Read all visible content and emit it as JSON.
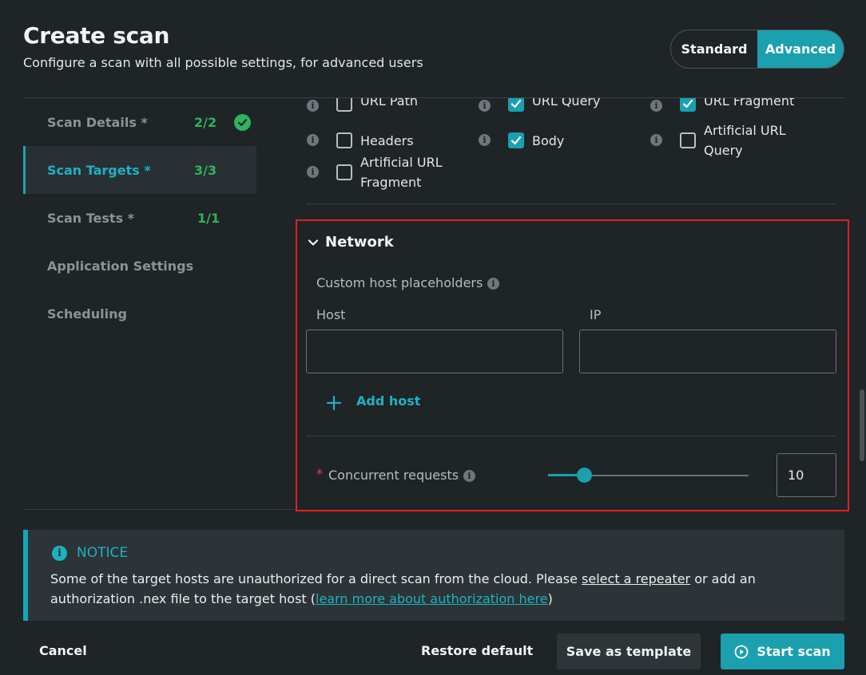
{
  "header": {
    "title": "Create scan",
    "subtitle": "Configure a scan with all possible settings, for advanced users",
    "mode_standard": "Standard",
    "mode_advanced": "Advanced",
    "active_mode": "Advanced"
  },
  "sidebar": {
    "items": [
      {
        "label": "Scan Details *",
        "count": "2/2",
        "completed": true,
        "active": false
      },
      {
        "label": "Scan Targets *",
        "count": "3/3",
        "completed": false,
        "active": true
      },
      {
        "label": "Scan Tests *",
        "count": "1/1",
        "completed": false,
        "active": false
      },
      {
        "label": "Application Settings",
        "count": "",
        "completed": false,
        "active": false
      },
      {
        "label": "Scheduling",
        "count": "",
        "completed": false,
        "active": false
      }
    ]
  },
  "targets": {
    "checkboxes": [
      {
        "label": "URL Path",
        "checked": false
      },
      {
        "label": "URL Query",
        "checked": true
      },
      {
        "label": "URL Fragment",
        "checked": true
      },
      {
        "label": "Headers",
        "checked": false
      },
      {
        "label": "Body",
        "checked": true
      },
      {
        "label": "Artificial URL",
        "label2": "Query",
        "checked": false
      },
      {
        "label": "Artificial URL",
        "label2": "Fragment",
        "checked": false
      }
    ]
  },
  "network": {
    "title": "Network",
    "placeholders_label": "Custom host placeholders",
    "host_label": "Host",
    "ip_label": "IP",
    "host_value": "",
    "ip_value": "",
    "add_host": "Add host",
    "required_mark": "*",
    "concurrent_label": "Concurrent requests",
    "concurrent_value": "10",
    "slider_fraction": 0.18
  },
  "notice": {
    "title": "NOTICE",
    "text_before": "Some of the target hosts are unauthorized for a direct scan from the cloud. Please ",
    "link_repeater": "select a repeater",
    "text_middle": " or add an",
    "text_line2": "authorization .nex file to the target host (",
    "link_auth": "learn more about authorization here",
    "text_end": ")"
  },
  "footer": {
    "cancel": "Cancel",
    "restore": "Restore default",
    "save_template": "Save as template",
    "start": "Start scan"
  },
  "colors": {
    "accent": "#1aa0ae",
    "success": "#2fb35c",
    "highlight": "#e01f1f",
    "background": "#1f2427"
  },
  "icons": [
    "check-circle-icon",
    "info-icon",
    "chevron-down-icon",
    "plus-icon",
    "play-circle-icon"
  ]
}
